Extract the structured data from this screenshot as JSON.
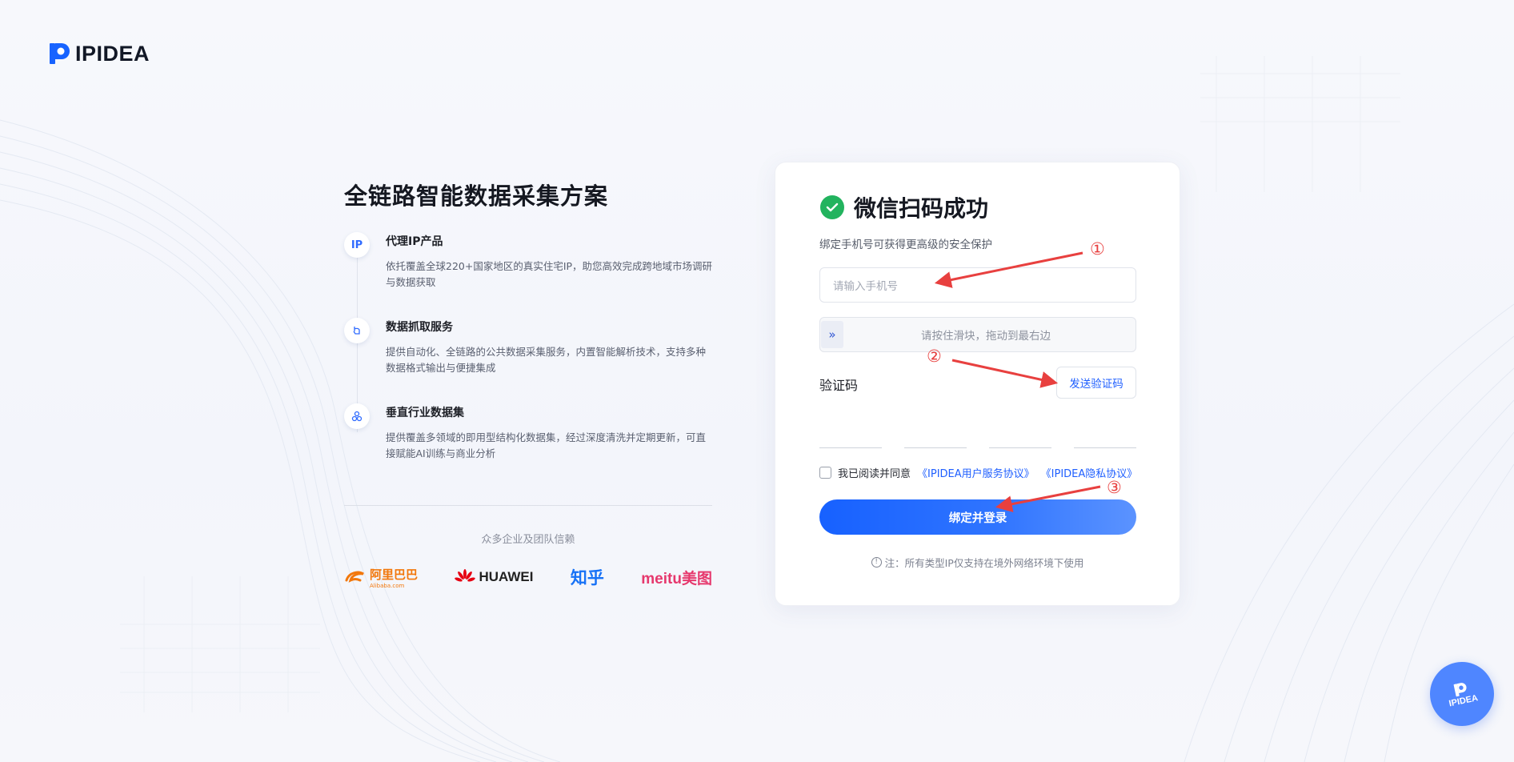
{
  "brand": {
    "name": "IPIDEA"
  },
  "hero": {
    "title": "全链路智能数据采集方案",
    "features": [
      {
        "icon": "ip-icon",
        "icon_text": "IP",
        "title": "代理IP产品",
        "desc": "依托覆盖全球220+国家地区的真实住宅IP，助您高效完成跨地域市场调研与数据获取"
      },
      {
        "icon": "scrape-icon",
        "title": "数据抓取服务",
        "desc": "提供自动化、全链路的公共数据采集服务，内置智能解析技术，支持多种数据格式输出与便捷集成"
      },
      {
        "icon": "dataset-icon",
        "title": "垂直行业数据集",
        "desc": "提供覆盖多领域的即用型结构化数据集，经过深度清洗并定期更新，可直接赋能AI训练与商业分析"
      }
    ],
    "trust_label": "众多企业及团队信赖",
    "brands": {
      "alibaba": "阿里巴巴",
      "alibaba_sub": "Alibaba.com",
      "huawei": "HUAWEI",
      "zhihu": "知乎",
      "meitu": "meitu美图"
    }
  },
  "card": {
    "title": "微信扫码成功",
    "subtitle": "绑定手机号可获得更高级的安全保护",
    "phone_placeholder": "请输入手机号",
    "slider_text": "请按住滑块，拖动到最右边",
    "code_label": "验证码",
    "send_code": "发送验证码",
    "agree_prefix": "我已阅读并同意",
    "user_agreement": "《IPIDEA用户服务协议》",
    "privacy_agreement": "《IPIDEA隐私协议》",
    "submit": "绑定并登录",
    "note": "注：所有类型IP仅支持在境外网络环境下使用"
  },
  "annotations": {
    "n1": "①",
    "n2": "②",
    "n3": "③"
  },
  "float_button": {
    "label": "IPIDEA"
  },
  "colors": {
    "primary": "#1f5fff",
    "success": "#22b35e",
    "annotation": "#e8403f"
  }
}
